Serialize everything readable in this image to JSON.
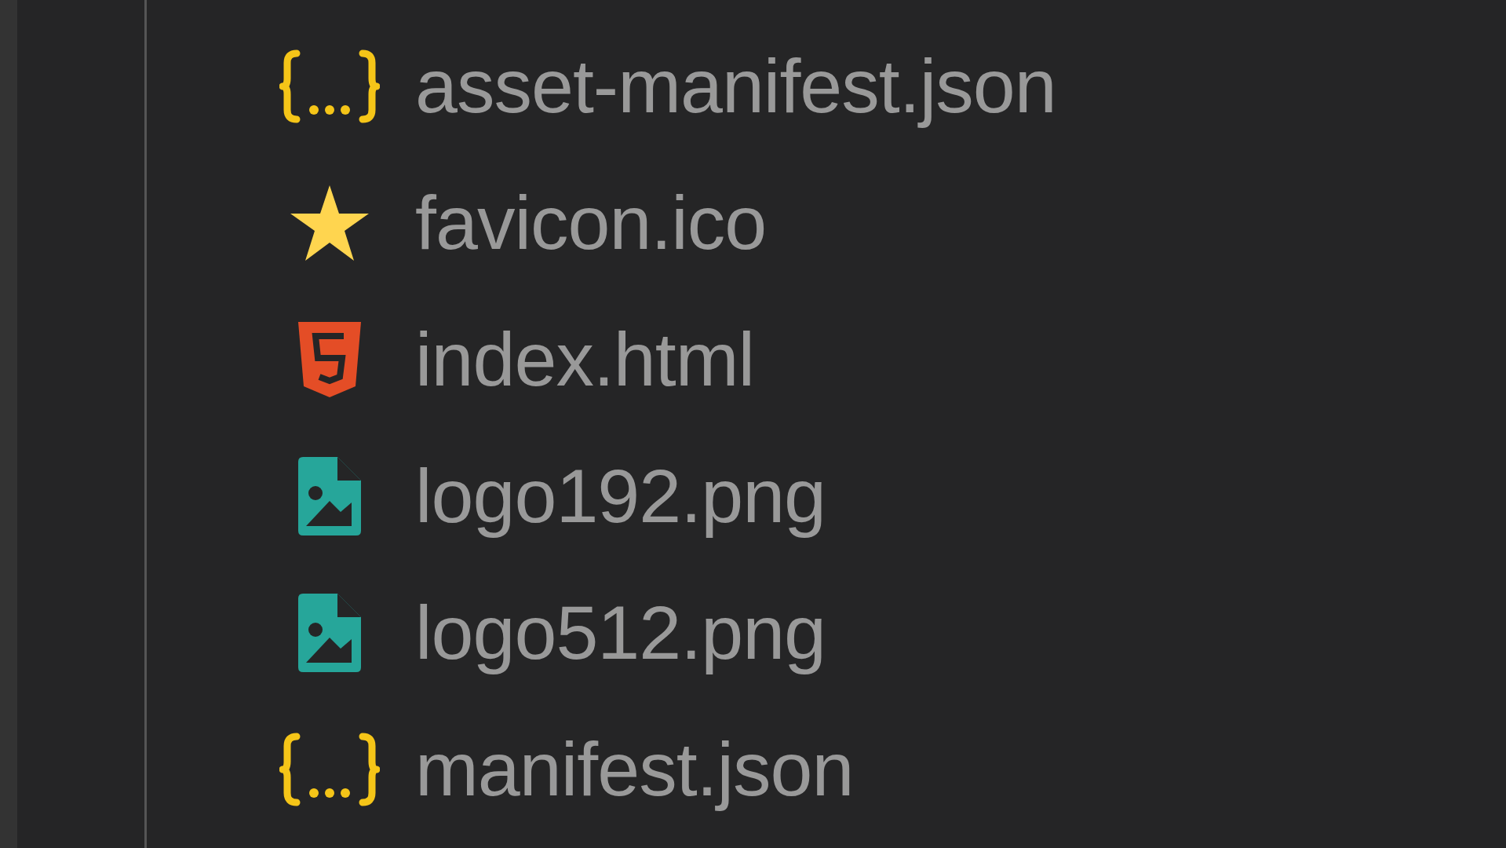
{
  "explorer": {
    "files": [
      {
        "name": "asset-manifest.json",
        "kind": "json"
      },
      {
        "name": "favicon.ico",
        "kind": "favicon"
      },
      {
        "name": "index.html",
        "kind": "html"
      },
      {
        "name": "logo192.png",
        "kind": "image"
      },
      {
        "name": "logo512.png",
        "kind": "image"
      },
      {
        "name": "manifest.json",
        "kind": "json"
      }
    ]
  }
}
